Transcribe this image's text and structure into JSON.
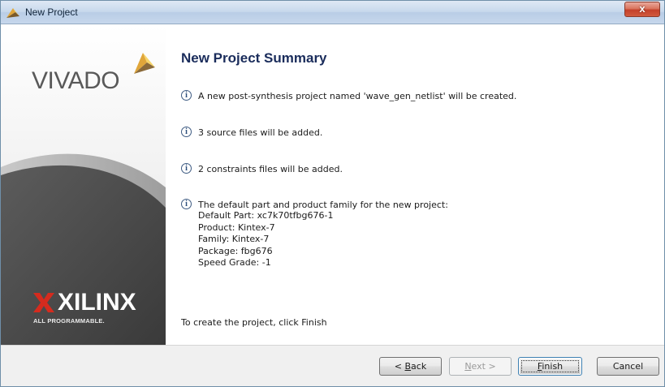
{
  "window": {
    "title": "New Project",
    "close_label": "x"
  },
  "banner": {
    "product_logo_text": "VIVADO",
    "company_logo_text": "XILINX",
    "company_tagline": "ALL PROGRAMMABLE."
  },
  "summary": {
    "heading": "New Project Summary",
    "items": [
      "A new post-synthesis project named 'wave_gen_netlist' will be created.",
      "3 source files will be added.",
      "2 constraints files will be added.",
      "The default part and product family for the new project:"
    ],
    "details": [
      "Default Part: xc7k70tfbg676-1",
      "Product: Kintex-7",
      "Family: Kintex-7",
      "Package: fbg676",
      "Speed Grade: -1"
    ],
    "finish_hint": "To create the project, click Finish",
    "info_icon_glyph": "i"
  },
  "buttons": {
    "back": {
      "prefix": "< ",
      "mnemonic": "B",
      "rest": "ack"
    },
    "next": {
      "mnemonic": "N",
      "rest": "ext >"
    },
    "finish": {
      "mnemonic": "F",
      "rest": "inish"
    },
    "cancel": {
      "label": "Cancel"
    }
  },
  "colors": {
    "banner_dark": "#4a4a4a",
    "logo_accent": "#e9b73b",
    "xilinx_red": "#d52b1e",
    "heading": "#1a2c5b"
  },
  "icons": {
    "title": "vivado-leaf-icon",
    "close": "close-icon",
    "info": "info-icon"
  }
}
